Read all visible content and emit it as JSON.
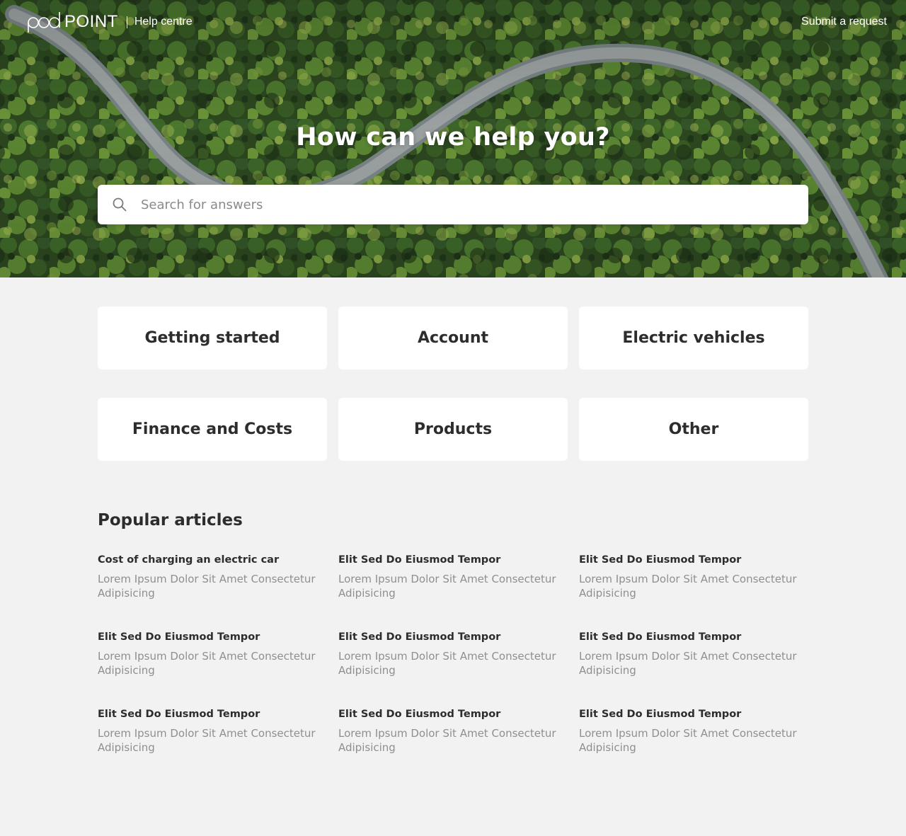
{
  "header": {
    "logo_text": "POINT",
    "help_label": "Help centre",
    "submit_label": "Submit a request"
  },
  "hero": {
    "title": "How can we help you?"
  },
  "search": {
    "placeholder": "Search for answers"
  },
  "categories": [
    {
      "label": "Getting started"
    },
    {
      "label": "Account"
    },
    {
      "label": "Electric vehicles"
    },
    {
      "label": "Finance and Costs"
    },
    {
      "label": "Products"
    },
    {
      "label": "Other"
    }
  ],
  "popular": {
    "title": "Popular articles",
    "articles": [
      {
        "title": "Cost of charging an electric car",
        "desc": "Lorem Ipsum Dolor Sit Amet Consectetur Adipisicing"
      },
      {
        "title": "Elit Sed Do Eiusmod Tempor",
        "desc": "Lorem Ipsum Dolor Sit Amet Consectetur Adipisicing"
      },
      {
        "title": "Elit Sed Do Eiusmod Tempor",
        "desc": "Lorem Ipsum Dolor Sit Amet Consectetur Adipisicing"
      },
      {
        "title": "Elit Sed Do Eiusmod Tempor",
        "desc": "Lorem Ipsum Dolor Sit Amet Consectetur Adipisicing"
      },
      {
        "title": "Elit Sed Do Eiusmod Tempor",
        "desc": "Lorem Ipsum Dolor Sit Amet Consectetur Adipisicing"
      },
      {
        "title": "Elit Sed Do Eiusmod Tempor",
        "desc": "Lorem Ipsum Dolor Sit Amet Consectetur Adipisicing"
      },
      {
        "title": "Elit Sed Do Eiusmod Tempor",
        "desc": "Lorem Ipsum Dolor Sit Amet Consectetur Adipisicing"
      },
      {
        "title": "Elit Sed Do Eiusmod Tempor",
        "desc": "Lorem Ipsum Dolor Sit Amet Consectetur Adipisicing"
      },
      {
        "title": "Elit Sed Do Eiusmod Tempor",
        "desc": "Lorem Ipsum Dolor Sit Amet Consectetur Adipisicing"
      }
    ]
  },
  "icons": {
    "search": "search-icon",
    "logo": "pod-logo-icon"
  },
  "colors": {
    "page_background": "#f2f2f2",
    "card_background": "#ffffff",
    "heading_text": "#2d2d2d",
    "muted_text": "#8f8f8f",
    "forest_green": "#2f4a22"
  }
}
